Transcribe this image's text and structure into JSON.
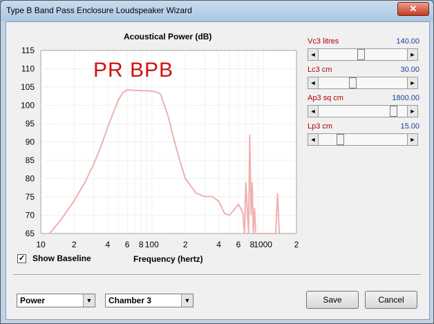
{
  "window": {
    "title": "Type B Band Pass Enclosure Loudspeaker Wizard",
    "close_icon": "close-icon"
  },
  "chart": {
    "title": "Acoustical Power (dB)",
    "xlabel": "Frequency (hertz)",
    "annotation": "PR BPB",
    "y_ticks": [
      "115",
      "110",
      "105",
      "100",
      "95",
      "90",
      "85",
      "80",
      "75",
      "70",
      "65"
    ],
    "x_ticks": [
      "10",
      "2",
      "4",
      "6",
      "8",
      "100",
      "2",
      "4",
      "6",
      "8",
      "1000",
      "2"
    ]
  },
  "chart_data": {
    "type": "line",
    "title": "Acoustical Power (dB)",
    "xlabel": "Frequency (hertz)",
    "ylabel": "",
    "xscale": "log",
    "xlim": [
      10,
      2000
    ],
    "ylim": [
      65,
      115
    ],
    "grid": true,
    "series": [
      {
        "color": "#f0b0b0",
        "x": [
          12,
          15,
          20,
          25,
          30,
          35,
          40,
          45,
          50,
          55,
          60,
          70,
          80,
          90,
          100,
          110,
          120,
          140,
          160,
          180,
          200,
          250,
          300,
          350,
          400,
          450,
          500,
          550,
          600,
          640,
          660,
          680,
          700,
          720,
          740,
          760,
          780,
          800,
          820,
          840,
          860,
          880,
          900,
          950,
          1000,
          1300,
          1350,
          1400
        ],
        "y": [
          65,
          68.5,
          74,
          79,
          84,
          89,
          94,
          98,
          101.5,
          103.5,
          104.2,
          104.1,
          104.0,
          104.0,
          103.9,
          103.6,
          103,
          97,
          90,
          84.5,
          80,
          76,
          75.1,
          75.1,
          73.8,
          70.5,
          70.0,
          71.5,
          73.0,
          71.5,
          70.3,
          65,
          79,
          72,
          65,
          92,
          70,
          79,
          65,
          72,
          65,
          65,
          65,
          65,
          65,
          65,
          76,
          65
        ]
      }
    ]
  },
  "baseline": {
    "label": "Show Baseline",
    "checked": true
  },
  "params": [
    {
      "label": "Vc3 litres",
      "value": "140.00",
      "position": 0.48
    },
    {
      "label": "Lc3 cm",
      "value": "30.00",
      "position": 0.38
    },
    {
      "label": "Ap3 sq cm",
      "value": "1800.00",
      "position": 0.88
    },
    {
      "label": "Lp3 cm",
      "value": "15.00",
      "position": 0.22
    }
  ],
  "footer": {
    "mode_select": "Power",
    "chamber_select": "Chamber 3",
    "save_label": "Save",
    "cancel_label": "Cancel"
  }
}
